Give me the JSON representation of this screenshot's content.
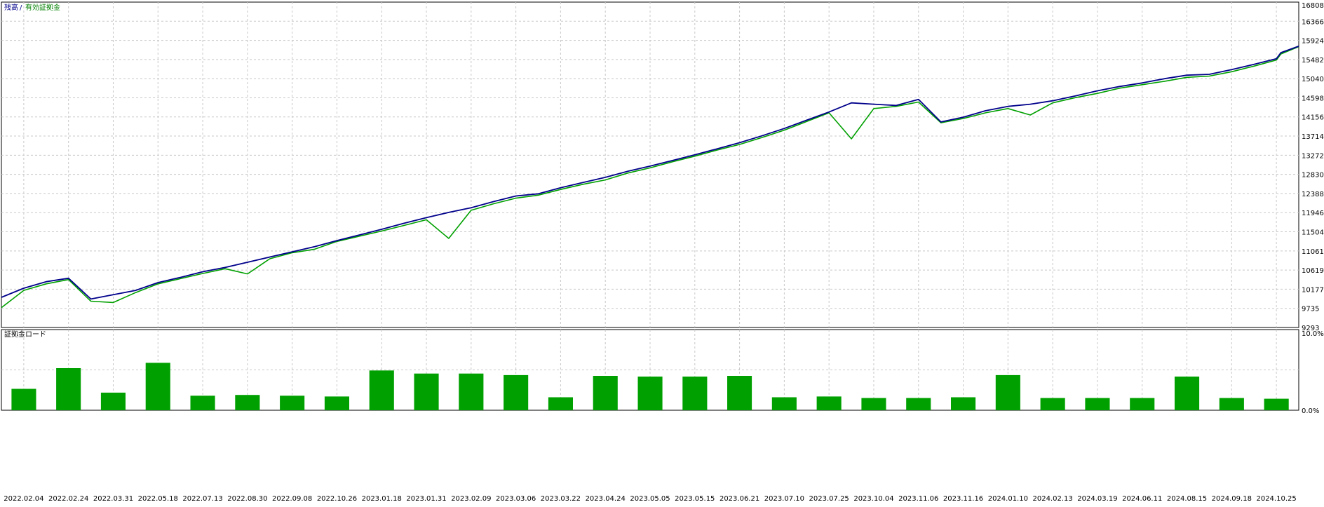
{
  "legend": {
    "balance_label": "残高",
    "separator": "/",
    "equity_label": "有効証拠金"
  },
  "lower_panel": {
    "title": "証拠金ロード",
    "y_top_label": "10.0%",
    "y_bottom_label": "0.0%"
  },
  "colors": {
    "balance": "#00008b",
    "equity": "#00a000",
    "bars": "#00a000",
    "grid": "#c8c8c8",
    "frame": "#000000",
    "background": "#ffffff"
  },
  "chart_data": [
    {
      "type": "line",
      "title": "",
      "ylim": [
        9293,
        16808
      ],
      "y_ticks": [
        "16808",
        "16366",
        "15924",
        "15482",
        "15040",
        "14598",
        "14156",
        "13714",
        "13272",
        "12830",
        "12388",
        "11946",
        "11504",
        "11061",
        "10619",
        "10177",
        "9735",
        "9293"
      ],
      "grid": true,
      "legend_position": "top-left",
      "series": [
        {
          "name": "残高",
          "color": "#00008b",
          "x": [
            0,
            0.5,
            1,
            1.5,
            2,
            2.5,
            3,
            3.5,
            4,
            4.5,
            5,
            5.5,
            6,
            6.5,
            7,
            7.5,
            8,
            8.5,
            9,
            9.5,
            10,
            10.5,
            11,
            11.5,
            12,
            12.5,
            13,
            13.5,
            14,
            14.5,
            15,
            15.5,
            16,
            16.5,
            17,
            17.5,
            18,
            18.5,
            19,
            19.5,
            20,
            20.5,
            21,
            21.5,
            22,
            22.5,
            23,
            23.5,
            24,
            24.5,
            25,
            25.5,
            26,
            26.5,
            27,
            27.5,
            28,
            28.5,
            28.6,
            29
          ],
          "y": [
            9990,
            10200,
            10350,
            10430,
            9950,
            10050,
            10150,
            10330,
            10450,
            10580,
            10680,
            10800,
            10920,
            11040,
            11160,
            11300,
            11430,
            11560,
            11700,
            11830,
            11950,
            12060,
            12200,
            12330,
            12380,
            12520,
            12640,
            12760,
            12900,
            13020,
            13150,
            13280,
            13420,
            13560,
            13720,
            13890,
            14080,
            14270,
            14480,
            14450,
            14420,
            14560,
            14040,
            14150,
            14300,
            14400,
            14450,
            14530,
            14640,
            14760,
            14860,
            14940,
            15040,
            15120,
            15140,
            15250,
            15370,
            15500,
            15640,
            15790
          ]
        },
        {
          "name": "有効証拠金",
          "color": "#00a000",
          "x": [
            0,
            0.5,
            1,
            1.5,
            2,
            2.5,
            3,
            3.5,
            4,
            4.5,
            5,
            5.5,
            6,
            6.5,
            7,
            7.5,
            8,
            8.5,
            9,
            9.5,
            10,
            10.5,
            11,
            11.5,
            12,
            12.5,
            13,
            13.5,
            14,
            14.5,
            15,
            15.5,
            16,
            16.5,
            17,
            17.5,
            18,
            18.5,
            19,
            19.5,
            20,
            20.5,
            21,
            21.5,
            22,
            22.5,
            23,
            23.5,
            24,
            24.5,
            25,
            25.5,
            26,
            26.5,
            27,
            27.5,
            28,
            28.5,
            28.6,
            29
          ],
          "y": [
            9750,
            10150,
            10300,
            10400,
            9900,
            9870,
            10100,
            10300,
            10420,
            10540,
            10650,
            10530,
            10880,
            11020,
            11100,
            11280,
            11400,
            11520,
            11650,
            11780,
            11350,
            12000,
            12150,
            12280,
            12350,
            12480,
            12600,
            12700,
            12860,
            12980,
            13120,
            13250,
            13390,
            13520,
            13680,
            13850,
            14050,
            14250,
            13650,
            14350,
            14400,
            14500,
            14020,
            14120,
            14250,
            14350,
            14200,
            14480,
            14600,
            14700,
            14820,
            14900,
            14980,
            15070,
            15100,
            15200,
            15330,
            15470,
            15610,
            15780
          ]
        }
      ]
    },
    {
      "type": "bar",
      "title": "証拠金ロード",
      "ylim": [
        0,
        10
      ],
      "y_ticks": [
        "10.0%",
        "0.0%"
      ],
      "categories": [
        "2022.02.04",
        "2022.02.24",
        "2022.03.31",
        "2022.05.18",
        "2022.07.13",
        "2022.08.30",
        "2022.09.08",
        "2022.10.26",
        "2023.01.18",
        "2023.01.31",
        "2023.02.09",
        "2023.03.06",
        "2023.03.22",
        "2023.04.24",
        "2023.05.05",
        "2023.05.15",
        "2023.06.21",
        "2023.07.10",
        "2023.07.25",
        "2023.10.04",
        "2023.11.06",
        "2023.11.16",
        "2024.01.10",
        "2024.02.13",
        "2024.03.19",
        "2024.06.11",
        "2024.08.15",
        "2024.09.18",
        "2024.10.25"
      ],
      "values": [
        2.8,
        5.5,
        2.3,
        6.2,
        1.9,
        2.0,
        1.9,
        1.8,
        5.2,
        4.8,
        4.8,
        4.6,
        1.7,
        4.5,
        4.4,
        4.4,
        4.5,
        1.7,
        1.8,
        1.6,
        1.6,
        1.7,
        4.6,
        1.6,
        1.6,
        1.6,
        4.4,
        1.6,
        1.5
      ]
    }
  ]
}
